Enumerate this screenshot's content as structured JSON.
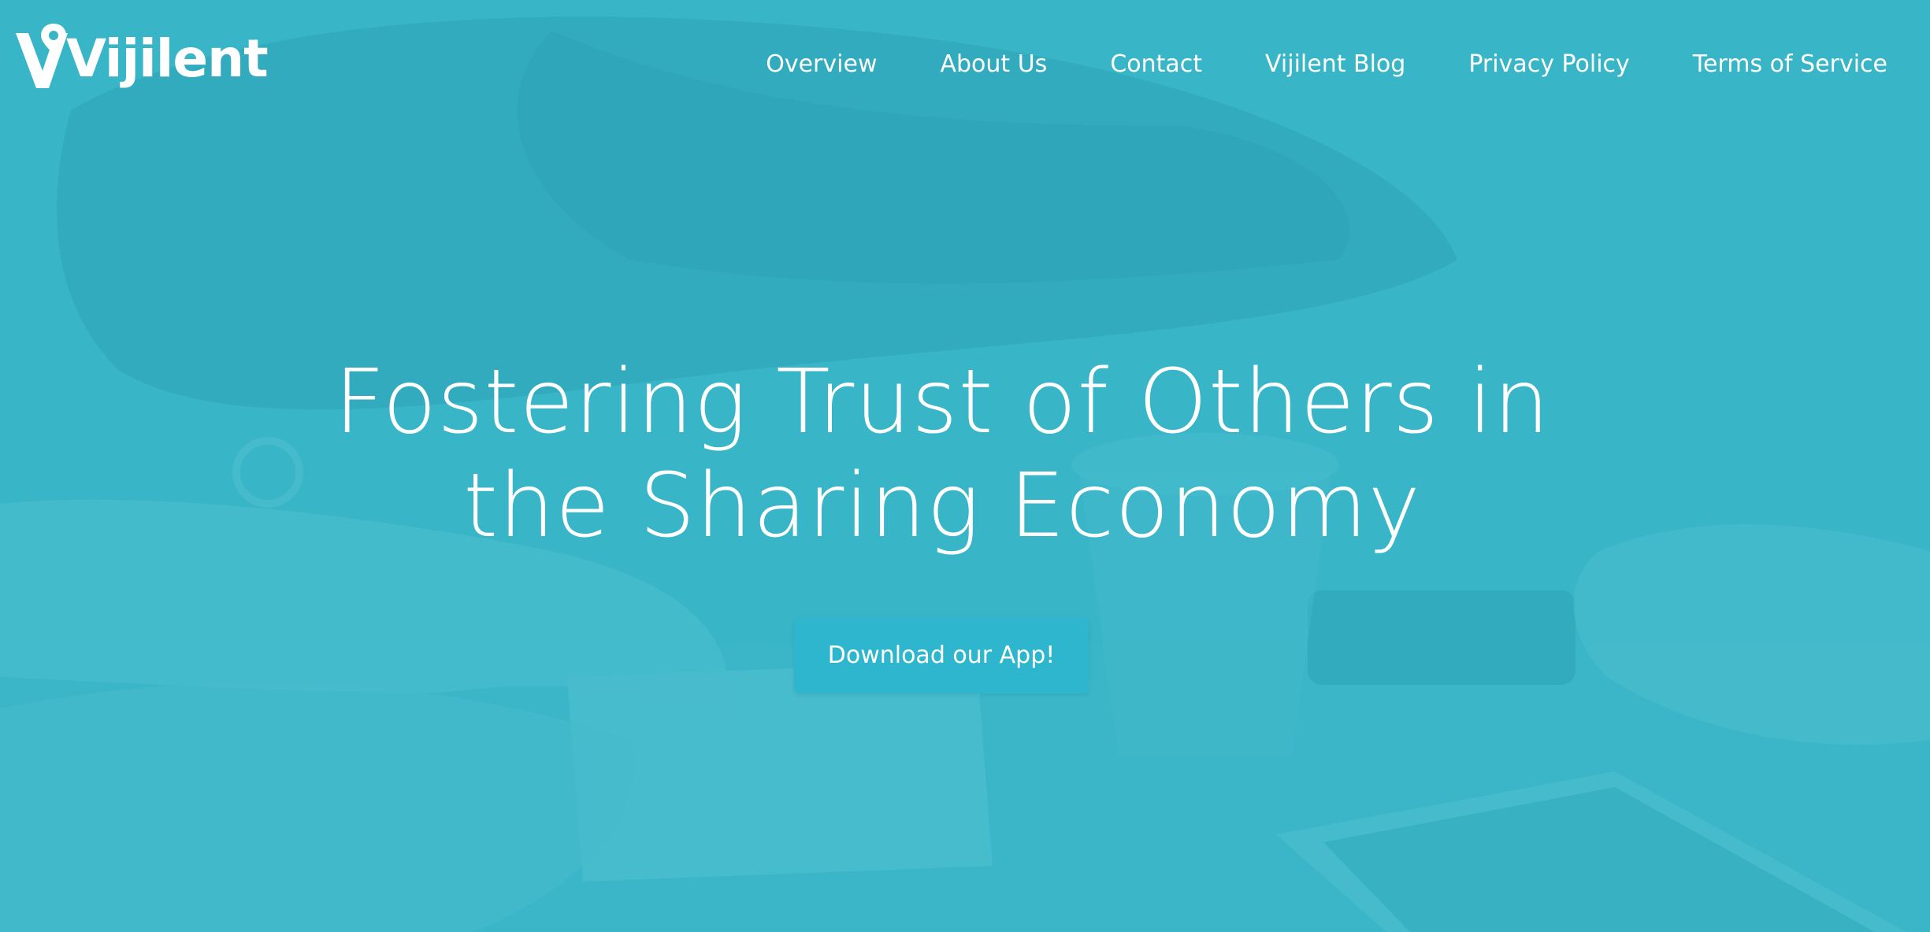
{
  "brand": {
    "name": "Vijilent",
    "logo_icon": "location-pin-icon",
    "color": "#36b3c6"
  },
  "nav": {
    "items": [
      {
        "label": "Overview"
      },
      {
        "label": "About Us"
      },
      {
        "label": "Contact"
      },
      {
        "label": "Vijilent Blog"
      },
      {
        "label": "Privacy Policy"
      },
      {
        "label": "Terms of Service"
      }
    ]
  },
  "hero": {
    "headline_line1": "Fostering Trust of Others in",
    "headline_line2": "the Sharing Economy",
    "cta_label": "Download our App!",
    "cta_color": "#2fb6cf"
  }
}
